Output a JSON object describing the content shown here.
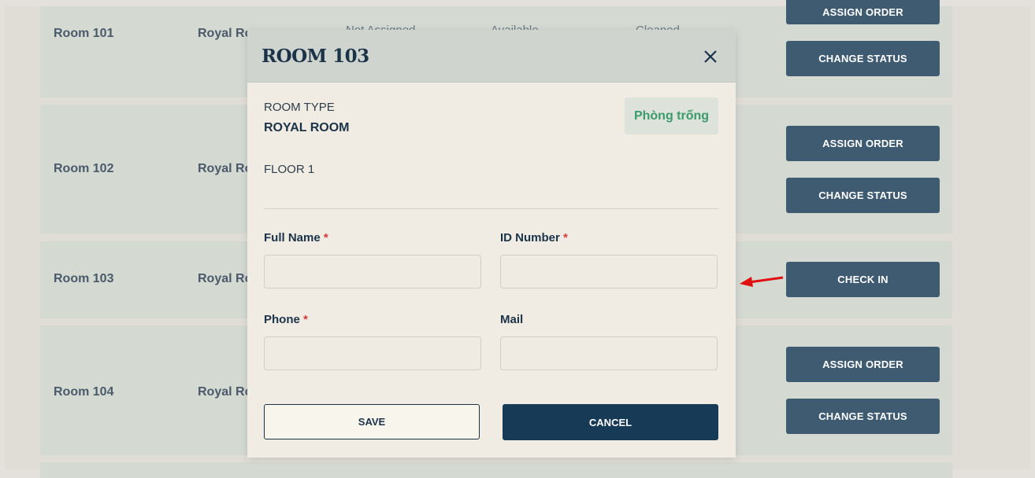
{
  "rows": [
    {
      "name": "Room 101",
      "type": "Royal Ro",
      "ghost": [
        "Not Assigned",
        "Available",
        "Cleaned"
      ]
    },
    {
      "name": "Room 102",
      "type": "Royal Ro"
    },
    {
      "name": "Room 103",
      "type": "Royal Ro"
    },
    {
      "name": "Room 104",
      "type": "Royal Ro"
    }
  ],
  "buttons": {
    "assign_order": "ASSIGN ORDER",
    "change_status": "CHANGE STATUS",
    "check_in": "CHECK IN"
  },
  "modal": {
    "title": "ROOM 103",
    "room_type_label": "ROOM TYPE",
    "room_type_value": "ROYAL ROOM",
    "floor": "FLOOR 1",
    "status": "Phòng trống",
    "fields": {
      "full_name": {
        "label": "Full Name",
        "required": "*",
        "value": "",
        "placeholder": ""
      },
      "id_number": {
        "label": "ID Number",
        "required": "*",
        "value": "",
        "placeholder": ""
      },
      "phone": {
        "label": "Phone",
        "required": "*",
        "value": "",
        "placeholder": ""
      },
      "mail": {
        "label": "Mail",
        "value": "",
        "placeholder": ""
      }
    },
    "save_label": "SAVE",
    "cancel_label": "CANCEL"
  },
  "colors": {
    "page_bg": "#e0ddd6",
    "row_bg": "#d4d9d2",
    "button_bg": "#3f5b72",
    "navy": "#1b3349",
    "status_green": "#3a9a6a",
    "required_red": "#d43b3b",
    "arrow_red": "#e01010"
  }
}
